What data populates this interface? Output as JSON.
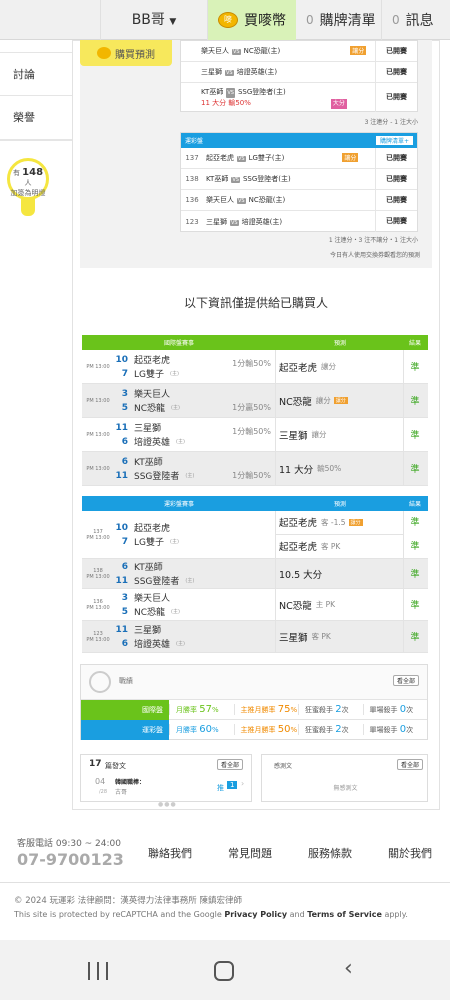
{
  "topbar": {
    "user": "BB哥",
    "buy_label": "買嘜幣",
    "buy_icon_text": "嘜",
    "list_count": "0",
    "list_label": "購牌清單",
    "msg_count": "0",
    "msg_label": "訊息"
  },
  "sidebar": {
    "items": [
      "討論",
      "榮譽"
    ],
    "bulb_prefix": "有",
    "bulb_count": "148",
    "bulb_unit": "人",
    "bulb_line2": "加簽為明燈"
  },
  "pred": {
    "badge": "購買預測",
    "intl_rows": [
      {
        "teams": "樂天巨人",
        "vs": "NC恐龍(主)",
        "tag": "讓分",
        "status": "已開賽"
      },
      {
        "teams": "三星獅",
        "vs": "培證英雄(主)",
        "status": "已開賽"
      },
      {
        "teams": "KT巫師",
        "vs": "SSG登陸者(主)",
        "extra": "11 大分 輸50%",
        "tag": "大分",
        "status": "已開賽"
      }
    ],
    "intl_note": "3 注連分 - 1 注大小",
    "lottery_header": "運彩盤",
    "lottery_btn": "購牌清單+",
    "lottery_rows": [
      {
        "no": "137",
        "teams": "起亞老虎",
        "vs": "LG雙子(主)",
        "tag": "讓分",
        "status": "已開賽"
      },
      {
        "no": "138",
        "teams": "KT巫師",
        "vs": "SSG登陸者(主)",
        "status": "已開賽"
      },
      {
        "no": "136",
        "teams": "樂天巨人",
        "vs": "NC恐龍(主)",
        "status": "已開賽"
      },
      {
        "no": "123",
        "teams": "三星獅",
        "vs": "培證英雄(主)",
        "status": "已開賽"
      }
    ],
    "lottery_note": "1 注連分・3 注不讓分・1 注大小",
    "footnote": "今日有人使用交換券觀看您的預測"
  },
  "section_title": "以下資訊僅提供給已購買人",
  "intl_table": {
    "headers": [
      "國際盤賽事",
      "預測",
      "結果"
    ],
    "rows": [
      {
        "time": "PM 13:00",
        "away_no": "10",
        "away": "起亞老虎",
        "home_no": "7",
        "home": "LG雙子",
        "home_tag": "(主)",
        "spread": "1分輸50%",
        "pick": "起亞老虎",
        "pick_sub": "讓分",
        "result": "準"
      },
      {
        "time": "PM 13:00",
        "away_no": "3",
        "away": "樂天巨人",
        "home_no": "5",
        "home": "NC恐龍",
        "home_tag": "(主)",
        "spread": "1分贏50%",
        "pick": "NC恐龍",
        "pick_sub": "讓分",
        "hot": "讓分",
        "result": "準"
      },
      {
        "time": "PM 13:00",
        "away_no": "11",
        "away": "三星獅",
        "home_no": "6",
        "home": "培證英雄",
        "home_tag": "(主)",
        "spread": "1分輸50%",
        "pick": "三星獅",
        "pick_sub": "讓分",
        "result": "準"
      },
      {
        "time": "PM 13:00",
        "away_no": "6",
        "away": "KT巫師",
        "home_no": "11",
        "home": "SSG登陸者",
        "home_tag": "(主)",
        "spread": "1分輸50%",
        "pick": "11 大分",
        "pick_sub": "輸50%",
        "result": "準"
      }
    ]
  },
  "lottery_table": {
    "headers": [
      "運彩盤賽事",
      "預測",
      "結果"
    ],
    "rows": [
      {
        "no": "137",
        "time": "PM 13:00",
        "away_no": "10",
        "away": "起亞老虎",
        "home_no": "7",
        "home": "LG雙子",
        "home_tag": "(主)",
        "picks": [
          {
            "pick": "起亞老虎",
            "sub": "客 -1.5",
            "hot": "讓分",
            "result": "準"
          },
          {
            "pick": "起亞老虎",
            "sub": "客 PK",
            "result": "準"
          }
        ]
      },
      {
        "no": "138",
        "time": "PM 13:00",
        "away_no": "6",
        "away": "KT巫師",
        "home_no": "11",
        "home": "SSG登陸者",
        "home_tag": "(主)",
        "picks": [
          {
            "pick": "10.5 大分",
            "sub": "",
            "result": "準"
          }
        ]
      },
      {
        "no": "136",
        "time": "PM 13:00",
        "away_no": "3",
        "away": "樂天巨人",
        "home_no": "5",
        "home": "NC恐龍",
        "home_tag": "(主)",
        "picks": [
          {
            "pick": "NC恐龍",
            "sub": "主 PK",
            "result": "準"
          }
        ]
      },
      {
        "no": "123",
        "time": "PM 13:00",
        "away_no": "11",
        "away": "三星獅",
        "home_no": "6",
        "home": "培證英雄",
        "home_tag": "(主)",
        "picks": [
          {
            "pick": "三星獅",
            "sub": "客 PK",
            "result": "準"
          }
        ]
      }
    ]
  },
  "stats": {
    "title": "戰績",
    "btn": "看全部",
    "rows": [
      {
        "label": "國際盤",
        "month_label": "月勝率",
        "month": "57",
        "pct": "%",
        "main_label": "主推月勝率",
        "main": "75",
        "streak_label": "狂蜜殺手",
        "streak": "2",
        "streak_unit": "次",
        "single_label": "單場殺手",
        "single": "0",
        "single_unit": "次",
        "color": "#6ac31b"
      },
      {
        "label": "運彩盤",
        "month_label": "月勝率",
        "month": "60",
        "pct": "%",
        "main_label": "主推月勝率",
        "main": "50",
        "streak_label": "狂蜜殺手",
        "streak": "2",
        "streak_unit": "次",
        "single_label": "單場殺手",
        "single": "0",
        "single_unit": "次",
        "color": "#1a9ee0"
      }
    ]
  },
  "posts": {
    "count": "17",
    "label": "篇發文",
    "btn": "看全部",
    "date_day": "04",
    "date_month": "/28",
    "title": "韓國職棒：",
    "author": "古哥",
    "push_label": "推",
    "push_count": "1"
  },
  "feel": {
    "label": "感測文",
    "btn": "看全部",
    "empty": "無感測文"
  },
  "footer": {
    "phone_label": "客服電話 09:30 ~ 24:00",
    "phone": "07-9700123",
    "links": [
      "聯絡我們",
      "常見問題",
      "服務條款",
      "關於我們"
    ],
    "copyright": "© 2024 玩運彩 法律顧問：漢英得力法律事務所 陳鎮宏律師",
    "captcha_a": "This site is protected by reCAPTCHA and the Google ",
    "privacy": "Privacy Policy",
    "and": " and ",
    "terms": "Terms of Service",
    "apply": " apply."
  }
}
